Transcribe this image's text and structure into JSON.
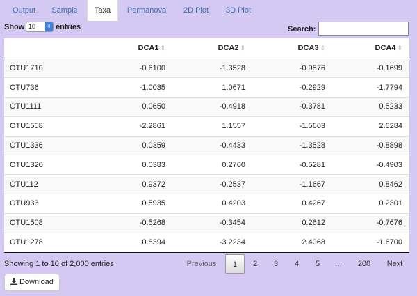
{
  "tabs": [
    {
      "label": "Output",
      "active": false
    },
    {
      "label": "Sample",
      "active": false
    },
    {
      "label": "Taxa",
      "active": true
    },
    {
      "label": "Permanova",
      "active": false
    },
    {
      "label": "2D Plot",
      "active": false
    },
    {
      "label": "3D Plot",
      "active": false
    }
  ],
  "controls": {
    "show_label": "Show",
    "entries_value": "10",
    "entries_label": "entries",
    "search_label": "Search:",
    "search_value": ""
  },
  "table": {
    "columns": [
      "",
      "DCA1",
      "DCA2",
      "DCA3",
      "DCA4"
    ],
    "rows": [
      [
        "OTU1710",
        "-0.6100",
        "-1.3528",
        "-0.9576",
        "-0.1699"
      ],
      [
        "OTU736",
        "-1.0035",
        "1.0671",
        "-0.2929",
        "-1.7794"
      ],
      [
        "OTU1111",
        "0.0650",
        "-0.4918",
        "-0.3781",
        "0.5233"
      ],
      [
        "OTU1558",
        "-2.2861",
        "1.1557",
        "-1.5663",
        "2.6284"
      ],
      [
        "OTU1336",
        "0.0359",
        "-0.4433",
        "-1.3528",
        "-0.8898"
      ],
      [
        "OTU1320",
        "0.0383",
        "0.2760",
        "-0.5281",
        "-0.4903"
      ],
      [
        "OTU112",
        "0.9372",
        "-0.2537",
        "-1.1667",
        "0.8462"
      ],
      [
        "OTU933",
        "0.5935",
        "0.4203",
        "0.4267",
        "0.2301"
      ],
      [
        "OTU1508",
        "-0.5268",
        "-0.3454",
        "0.2612",
        "-0.7676"
      ],
      [
        "OTU1278",
        "0.8394",
        "-3.2234",
        "2.4068",
        "-1.6700"
      ]
    ]
  },
  "footer": {
    "info": "Showing 1 to 10 of 2,000 entries",
    "previous": "Previous",
    "pages": [
      "1",
      "2",
      "3",
      "4",
      "5",
      "…",
      "200"
    ],
    "current_page": "1",
    "next": "Next"
  },
  "download": {
    "label": "Download",
    "icon": "download-icon"
  },
  "colors": {
    "background": "#d4c9f2",
    "link": "#3a6fb3",
    "select_accent": "#3b7ee0"
  }
}
